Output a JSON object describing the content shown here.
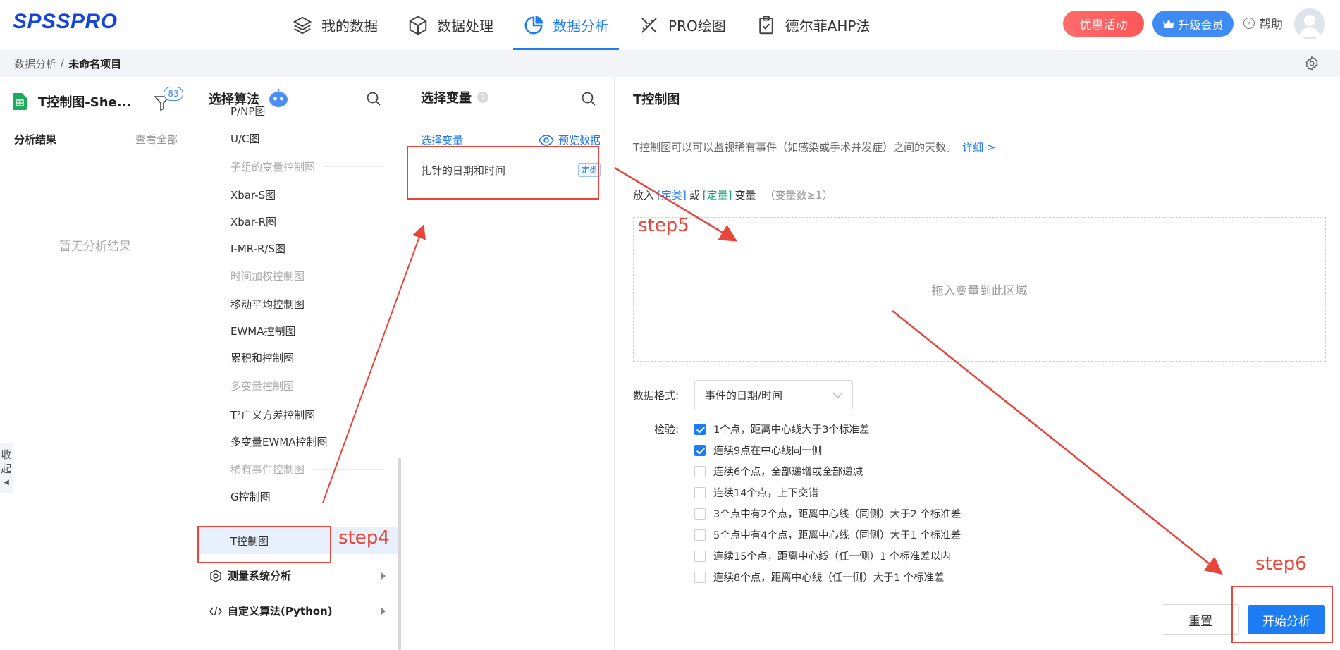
{
  "app": {
    "logo": "SPSSPRO"
  },
  "nav": {
    "items": [
      {
        "label": "我的数据"
      },
      {
        "label": "数据处理"
      },
      {
        "label": "数据分析"
      },
      {
        "label": "PRO绘图"
      },
      {
        "label": "德尔菲AHP法"
      }
    ],
    "active_index": 2,
    "promo": "优惠活动",
    "vip": "升级会员",
    "help": "帮助"
  },
  "breadcrumb": {
    "root": "数据分析",
    "sep": "/",
    "current": "未命名项目"
  },
  "results_panel": {
    "file_name": "T控制图-She...",
    "filter_count": "83",
    "title": "分析结果",
    "view_all": "查看全部",
    "empty": "暂无分析结果",
    "collapse_1": "收",
    "collapse_2": "起"
  },
  "algo_panel": {
    "title": "选择算法",
    "items": {
      "pnp": "P/NP图",
      "uc": "U/C图",
      "g_subgroup": "子组的变量控制图",
      "xbar_s": "Xbar-S图",
      "xbar_r": "Xbar-R图",
      "imr": "I-MR-R/S图",
      "g_timeweighted": "时间加权控制图",
      "ma": "移动平均控制图",
      "ewma": "EWMA控制图",
      "cusum": "累积和控制图",
      "g_multivariate": "多变量控制图",
      "t2": "T²广义方差控制图",
      "mewma": "多变量EWMA控制图",
      "g_rare": "稀有事件控制图",
      "g_chart": "G控制图",
      "t_chart": "T控制图"
    },
    "cat_msa": "测量系统分析",
    "cat_python": "自定义算法(Python)"
  },
  "vars_panel": {
    "title": "选择变量",
    "sub": "选择变量",
    "preview": "预览数据",
    "variable": "扎针的日期和时间",
    "variable_tag": "定类"
  },
  "config": {
    "title": "T控制图",
    "desc": "T控制图可以可以监视稀有事件（如感染或手术并发症）之间的天数。",
    "more": "详细 >",
    "drop_prefix": "放入",
    "drop_cat": "[定类]",
    "drop_or": "或",
    "drop_quant": "[定量]",
    "drop_suffix": "变量",
    "drop_count": "（变量数≥1）",
    "dropzone": "拖入变量到此区域",
    "format_label": "数据格式:",
    "format_value": "事件的日期/时间",
    "checks_label": "检验:",
    "checks": [
      {
        "label": "1个点，距离中心线大于3个标准差",
        "checked": true
      },
      {
        "label": "连续9点在中心线同一侧",
        "checked": true
      },
      {
        "label": "连续6个点，全部递增或全部递减",
        "checked": false
      },
      {
        "label": "连续14个点，上下交错",
        "checked": false
      },
      {
        "label": "3个点中有2个点，距离中心线（同侧）大于2 个标准差",
        "checked": false
      },
      {
        "label": "5个点中有4个点，距离中心线（同侧）大于1 个标准差",
        "checked": false
      },
      {
        "label": "连续15个点，距离中心线（任一侧）1 个标准差以内",
        "checked": false
      },
      {
        "label": "连续8个点，距离中心线（任一侧）大于1 个标准差",
        "checked": false
      }
    ],
    "reset": "重置",
    "start": "开始分析"
  },
  "annotations": {
    "step4": "step4",
    "step5": "step5",
    "step6": "step6"
  },
  "colors": {
    "accent": "#1e7cf2",
    "promo": "#fe5757",
    "annotation": "#e8463a"
  }
}
